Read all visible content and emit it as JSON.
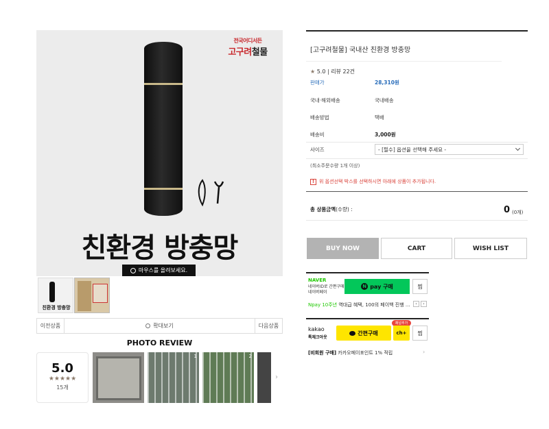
{
  "gallery": {
    "brand_line1": "전국어디서든",
    "brand_line2_red": "고구려",
    "brand_line2_dark": "철물",
    "hero_text": "친환경 방충망",
    "hover_hint": "마우스를 올려보세요.",
    "thumb1_text": "친환경 방충망",
    "prev_label": "이전상품",
    "zoom_label": "확대보기",
    "next_label": "다음상품"
  },
  "review": {
    "title": "PHOTO REVIEW",
    "score": "5.0",
    "stars": "★★★★★",
    "count": "15개",
    "photo_nums": [
      "1",
      "2"
    ]
  },
  "product": {
    "name": "[고구려철물] 국내산 친환경 방충망",
    "rating_star": "★",
    "rating_text": "5.0 | 리뷰 22건",
    "rows": [
      {
        "label": "판매가",
        "value": "28,310원"
      },
      {
        "label": "국내·해외배송",
        "value": "국내배송"
      },
      {
        "label": "배송방법",
        "value": "택배"
      },
      {
        "label": "배송비",
        "value": "3,000원"
      },
      {
        "label": "사이즈",
        "value": "- [필수] 옵션을 선택해 주세요 -"
      }
    ],
    "min_order": "(최소주문수량 1개 이상)",
    "option_notice_icon": "!",
    "option_notice": "위 옵션선택 박스를 선택하시면 아래에 상품이 추가됩니다.",
    "total_label_bold": "총 상품금액",
    "total_label_rest": "(수량) :",
    "total_value": "0",
    "total_unit": "(0개)"
  },
  "actions": {
    "buy_now": "BUY NOW",
    "cart": "CART",
    "wish": "WISH LIST"
  },
  "naver": {
    "logo": "NAVER",
    "sub1": "네이버ID로 간편구매",
    "sub2": "네이버페이",
    "pay_label": "pay 구매",
    "zzim": "찜",
    "promo_green": "Npay 10주년",
    "promo_rest": " 역대급 혜택, 100의 페이백 진행 ..."
  },
  "kakao": {
    "logo": "kakao",
    "sub": "톡체크아웃",
    "buy_label": "간편구매",
    "plus_badge": "채널추가",
    "plus_label": "ch+",
    "zzim": "찜",
    "promo_bold": "[비회원 구매]",
    "promo_rest": " 카카오페이포인트 1% 적립"
  },
  "colors": {
    "price_blue": "#2a6ebb",
    "notice_red": "#d9423a",
    "naver_green": "#03c75a",
    "kakao_yellow": "#fee500",
    "buy_now_gray": "#b3b3b3"
  }
}
